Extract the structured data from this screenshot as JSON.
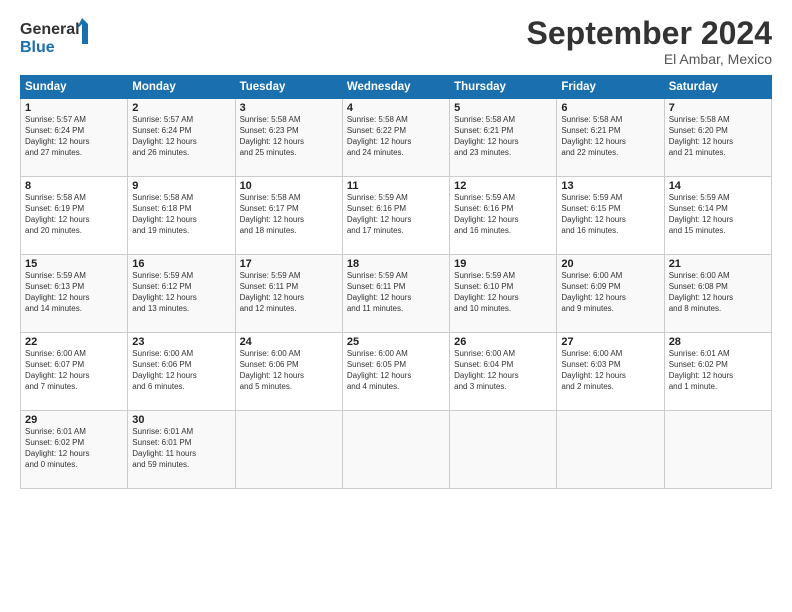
{
  "logo": {
    "line1": "General",
    "line2": "Blue"
  },
  "title": "September 2024",
  "location": "El Ambar, Mexico",
  "weekdays": [
    "Sunday",
    "Monday",
    "Tuesday",
    "Wednesday",
    "Thursday",
    "Friday",
    "Saturday"
  ],
  "weeks": [
    [
      {
        "day": "1",
        "info": "Sunrise: 5:57 AM\nSunset: 6:24 PM\nDaylight: 12 hours\nand 27 minutes."
      },
      {
        "day": "2",
        "info": "Sunrise: 5:57 AM\nSunset: 6:24 PM\nDaylight: 12 hours\nand 26 minutes."
      },
      {
        "day": "3",
        "info": "Sunrise: 5:58 AM\nSunset: 6:23 PM\nDaylight: 12 hours\nand 25 minutes."
      },
      {
        "day": "4",
        "info": "Sunrise: 5:58 AM\nSunset: 6:22 PM\nDaylight: 12 hours\nand 24 minutes."
      },
      {
        "day": "5",
        "info": "Sunrise: 5:58 AM\nSunset: 6:21 PM\nDaylight: 12 hours\nand 23 minutes."
      },
      {
        "day": "6",
        "info": "Sunrise: 5:58 AM\nSunset: 6:21 PM\nDaylight: 12 hours\nand 22 minutes."
      },
      {
        "day": "7",
        "info": "Sunrise: 5:58 AM\nSunset: 6:20 PM\nDaylight: 12 hours\nand 21 minutes."
      }
    ],
    [
      {
        "day": "8",
        "info": "Sunrise: 5:58 AM\nSunset: 6:19 PM\nDaylight: 12 hours\nand 20 minutes."
      },
      {
        "day": "9",
        "info": "Sunrise: 5:58 AM\nSunset: 6:18 PM\nDaylight: 12 hours\nand 19 minutes."
      },
      {
        "day": "10",
        "info": "Sunrise: 5:58 AM\nSunset: 6:17 PM\nDaylight: 12 hours\nand 18 minutes."
      },
      {
        "day": "11",
        "info": "Sunrise: 5:59 AM\nSunset: 6:16 PM\nDaylight: 12 hours\nand 17 minutes."
      },
      {
        "day": "12",
        "info": "Sunrise: 5:59 AM\nSunset: 6:16 PM\nDaylight: 12 hours\nand 16 minutes."
      },
      {
        "day": "13",
        "info": "Sunrise: 5:59 AM\nSunset: 6:15 PM\nDaylight: 12 hours\nand 16 minutes."
      },
      {
        "day": "14",
        "info": "Sunrise: 5:59 AM\nSunset: 6:14 PM\nDaylight: 12 hours\nand 15 minutes."
      }
    ],
    [
      {
        "day": "15",
        "info": "Sunrise: 5:59 AM\nSunset: 6:13 PM\nDaylight: 12 hours\nand 14 minutes."
      },
      {
        "day": "16",
        "info": "Sunrise: 5:59 AM\nSunset: 6:12 PM\nDaylight: 12 hours\nand 13 minutes."
      },
      {
        "day": "17",
        "info": "Sunrise: 5:59 AM\nSunset: 6:11 PM\nDaylight: 12 hours\nand 12 minutes."
      },
      {
        "day": "18",
        "info": "Sunrise: 5:59 AM\nSunset: 6:11 PM\nDaylight: 12 hours\nand 11 minutes."
      },
      {
        "day": "19",
        "info": "Sunrise: 5:59 AM\nSunset: 6:10 PM\nDaylight: 12 hours\nand 10 minutes."
      },
      {
        "day": "20",
        "info": "Sunrise: 6:00 AM\nSunset: 6:09 PM\nDaylight: 12 hours\nand 9 minutes."
      },
      {
        "day": "21",
        "info": "Sunrise: 6:00 AM\nSunset: 6:08 PM\nDaylight: 12 hours\nand 8 minutes."
      }
    ],
    [
      {
        "day": "22",
        "info": "Sunrise: 6:00 AM\nSunset: 6:07 PM\nDaylight: 12 hours\nand 7 minutes."
      },
      {
        "day": "23",
        "info": "Sunrise: 6:00 AM\nSunset: 6:06 PM\nDaylight: 12 hours\nand 6 minutes."
      },
      {
        "day": "24",
        "info": "Sunrise: 6:00 AM\nSunset: 6:06 PM\nDaylight: 12 hours\nand 5 minutes."
      },
      {
        "day": "25",
        "info": "Sunrise: 6:00 AM\nSunset: 6:05 PM\nDaylight: 12 hours\nand 4 minutes."
      },
      {
        "day": "26",
        "info": "Sunrise: 6:00 AM\nSunset: 6:04 PM\nDaylight: 12 hours\nand 3 minutes."
      },
      {
        "day": "27",
        "info": "Sunrise: 6:00 AM\nSunset: 6:03 PM\nDaylight: 12 hours\nand 2 minutes."
      },
      {
        "day": "28",
        "info": "Sunrise: 6:01 AM\nSunset: 6:02 PM\nDaylight: 12 hours\nand 1 minute."
      }
    ],
    [
      {
        "day": "29",
        "info": "Sunrise: 6:01 AM\nSunset: 6:02 PM\nDaylight: 12 hours\nand 0 minutes."
      },
      {
        "day": "30",
        "info": "Sunrise: 6:01 AM\nSunset: 6:01 PM\nDaylight: 11 hours\nand 59 minutes."
      },
      {
        "day": "",
        "info": ""
      },
      {
        "day": "",
        "info": ""
      },
      {
        "day": "",
        "info": ""
      },
      {
        "day": "",
        "info": ""
      },
      {
        "day": "",
        "info": ""
      }
    ]
  ]
}
